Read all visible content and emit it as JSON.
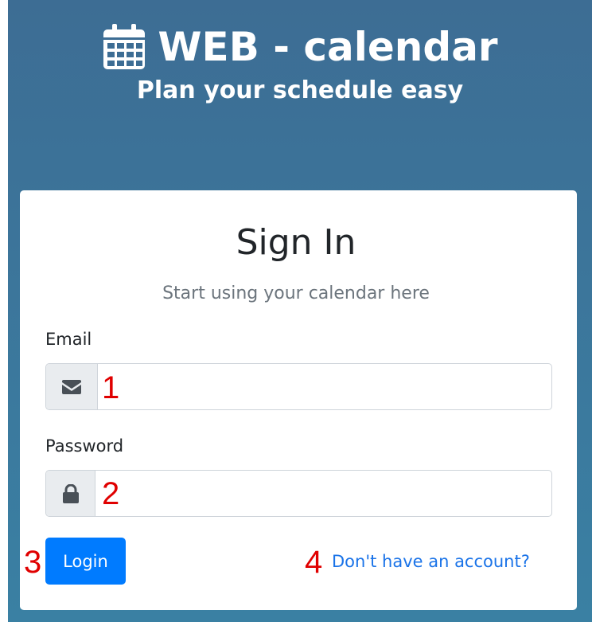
{
  "header": {
    "title": "WEB - calendar",
    "subtitle": "Plan your schedule easy"
  },
  "signin": {
    "title": "Sign In",
    "subtitle": "Start using your calendar here",
    "email": {
      "label": "Email",
      "value": "",
      "icon": "envelope-icon"
    },
    "password": {
      "label": "Password",
      "value": "",
      "icon": "lock-icon"
    },
    "login_label": "Login",
    "signup_link": "Don't have an account?"
  },
  "annotations": [
    "1",
    "2",
    "3",
    "4"
  ],
  "colors": {
    "background": "#3d77a0",
    "primary": "#007bff",
    "link": "#1a73e8",
    "annotation": "#e00000"
  }
}
